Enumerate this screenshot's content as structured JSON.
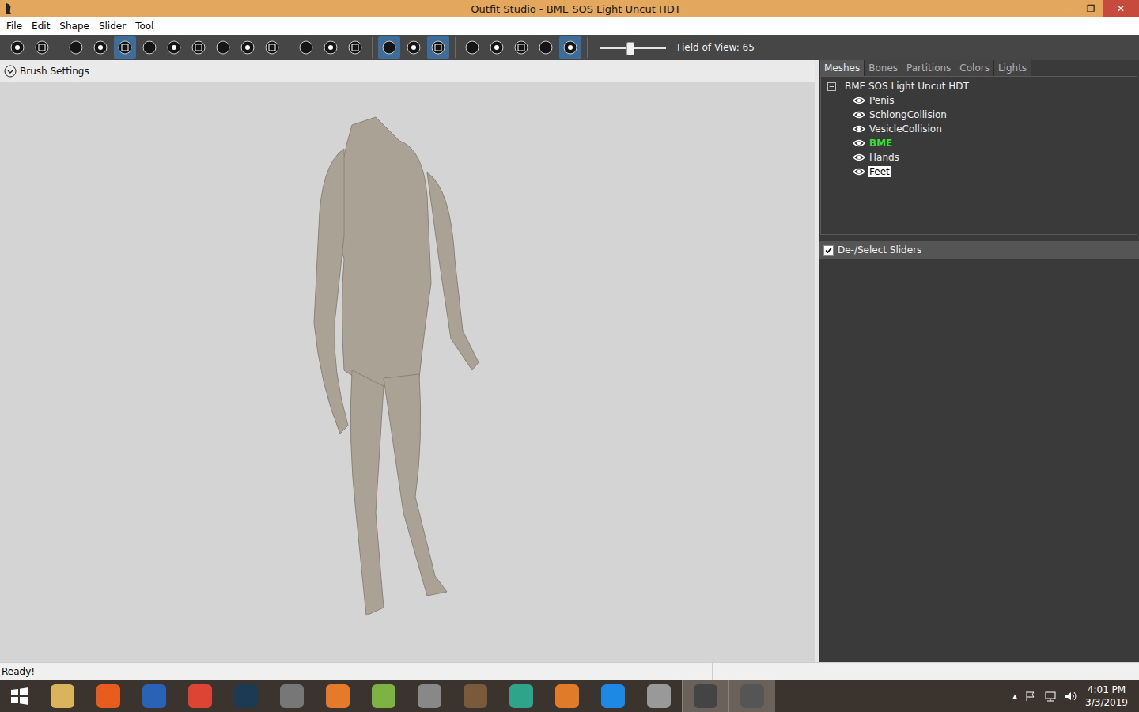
{
  "window": {
    "title": "Outfit Studio - BME SOS Light Uncut HDT",
    "controls": [
      "–",
      "❐",
      "✕"
    ]
  },
  "menu": [
    "File",
    "Edit",
    "Shape",
    "Slider",
    "Tool"
  ],
  "toolbar": {
    "groups": [
      [
        {
          "selected": false
        },
        {
          "selected": false
        }
      ],
      [
        {
          "selected": false
        },
        {
          "selected": false
        },
        {
          "selected": true
        },
        {
          "selected": false
        },
        {
          "selected": false
        },
        {
          "selected": false
        },
        {
          "selected": false
        },
        {
          "selected": false
        },
        {
          "selected": false
        }
      ],
      [
        {
          "selected": false
        },
        {
          "selected": false
        },
        {
          "selected": false
        }
      ],
      [
        {
          "selected": true
        },
        {
          "selected": false
        },
        {
          "selected": true
        }
      ],
      [
        {
          "selected": false
        },
        {
          "selected": false
        },
        {
          "selected": false
        },
        {
          "selected": false
        },
        {
          "selected": true
        }
      ]
    ],
    "fov_slider": {
      "level": 0.45
    },
    "fov_label": "Field of View: 65"
  },
  "brush_settings": {
    "label": "Brush Settings",
    "expanded": false
  },
  "panel": {
    "tabs": [
      {
        "label": "Meshes",
        "selected": true
      },
      {
        "label": "Bones",
        "selected": false
      },
      {
        "label": "Partitions",
        "selected": false
      },
      {
        "label": "Colors",
        "selected": false
      },
      {
        "label": "Lights",
        "selected": false
      }
    ],
    "tree": {
      "root": "BME SOS Light Uncut HDT",
      "expanded": true,
      "expander": "−",
      "items": [
        {
          "label": "Penis",
          "visible": true,
          "active": false,
          "selected": false
        },
        {
          "label": "SchlongCollision",
          "visible": true,
          "active": false,
          "selected": false
        },
        {
          "label": "VesicleCollision",
          "visible": true,
          "active": false,
          "selected": false
        },
        {
          "label": "BME",
          "visible": true,
          "active": true,
          "selected": false
        },
        {
          "label": "Hands",
          "visible": true,
          "active": false,
          "selected": false
        },
        {
          "label": "Feet",
          "visible": true,
          "active": false,
          "selected": true
        }
      ]
    },
    "sliders_header": {
      "label": "De-/Select Sliders",
      "checked": true
    }
  },
  "status_bar": "Ready!",
  "taskbar": {
    "apps": [
      {
        "active": false
      },
      {
        "active": false
      },
      {
        "active": false
      },
      {
        "active": false
      },
      {
        "active": false
      },
      {
        "active": false
      },
      {
        "active": false
      },
      {
        "active": false
      },
      {
        "active": false
      },
      {
        "active": false
      },
      {
        "active": false
      },
      {
        "active": false
      },
      {
        "active": false
      },
      {
        "active": false
      },
      {
        "active": true
      },
      {
        "active": true
      }
    ],
    "tray_expander": "▲",
    "time": "4:01 PM",
    "date": "3/3/2019"
  }
}
